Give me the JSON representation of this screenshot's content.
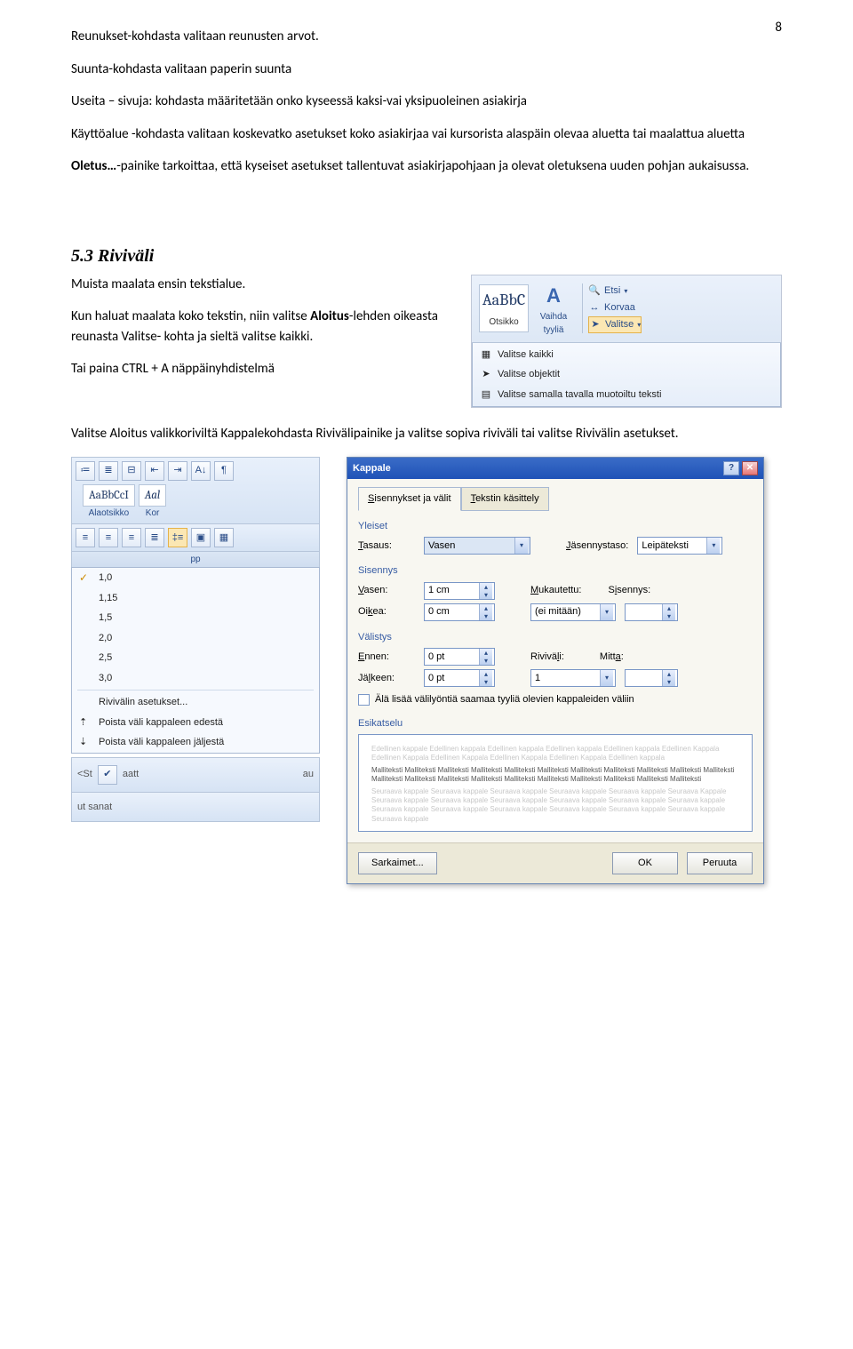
{
  "page_number": "8",
  "p1": "Reunukset-kohdasta  valitaan reunusten arvot.",
  "p2": "Suunta-kohdasta valitaan paperin suunta",
  "p3": "Useita – sivuja: kohdasta määritetään onko kyseessä kaksi-vai yksipuoleinen asiakirja",
  "p4": "Käyttöalue -kohdasta valitaan  koskevatko asetukset koko asiakirjaa vai kursorista alaspäin olevaa aluetta tai maalattua aluetta",
  "p5a": "Oletus…",
  "p5b": "-painike tarkoittaa, että kyseiset asetukset tallentuvat asiakirjapohjaan ja olevat oletuksena uuden pohjan aukaisussa.",
  "h53": "5.3 Riviväli",
  "r1": "Muista maalata ensin tekstialue.",
  "r2a": "Kun haluat maalata koko tekstin, niin valitse ",
  "r2b": "Aloitus",
  "r2c": "-lehden oikeasta reunasta Valitse- kohta  ja sieltä valitse kaikki.",
  "r3": "Tai paina CTRL + A näppäinyhdistelmä",
  "r4": "Valitse Aloitus valikkoriviltä Kappalekohdasta Rivivälipainike ja valitse sopiva riviväli tai valitse Rivivälin asetukset.",
  "ribbon": {
    "style1_aa": "AaBbC",
    "style1_lbl": "Otsikko",
    "changeStyle": "Vaihda tyyliä",
    "find": "Etsi",
    "replace": "Korvaa",
    "select": "Valitse",
    "selMenu": {
      "all": "Valitse kaikki",
      "objects": "Valitse objektit",
      "similar": "Valitse samalla tavalla muotoiltu teksti"
    }
  },
  "linespace": {
    "tb_style1": "AaBbCcI",
    "tb_style1_lbl": "Alaotsikko",
    "tb_style2": "Aal",
    "tb_style2_lbl": "Kor",
    "pp": "pp",
    "items": [
      "1,0",
      "1,15",
      "1,5",
      "2,0",
      "2,5",
      "3,0"
    ],
    "settings": "Rivivälin asetukset...",
    "removeBefore": "Poista väli kappaleen edestä",
    "removeAfter": "Poista väli kappaleen jäljestä",
    "extraleft1": "<St",
    "extraleft2": "aatt",
    "extraleft3": "ut sanat",
    "extraleft4": "au"
  },
  "dialog": {
    "title": "Kappale",
    "tab1": "Sisennykset ja välit",
    "tab2": "Tekstin käsittely",
    "g_general": "Yleiset",
    "l_align": "Tasaus:",
    "v_align": "Vasen",
    "l_outline": "Jäsennystaso:",
    "v_outline": "Leipäteksti",
    "g_indent": "Sisennys",
    "l_left": "Vasen:",
    "v_left": "1 cm",
    "l_right": "Oikea:",
    "v_right": "0 cm",
    "l_special": "Mukautettu:",
    "v_special": "(ei mitään)",
    "l_by": "Sisennys:",
    "g_spacing": "Välistys",
    "l_before": "Ennen:",
    "v_before": "0 pt",
    "l_after": "Jälkeen:",
    "v_after": "0 pt",
    "l_linespace": "Riviväli:",
    "v_linespace": "1",
    "l_at": "Mitta:",
    "chk_nospace": "Älä lisää välilyöntiä saamaa tyyliä olevien kappaleiden väliin",
    "g_preview": "Esikatselu",
    "btn_tabs": "Sarkaimet...",
    "btn_ok": "OK",
    "btn_cancel": "Peruuta",
    "prev_light": "Edellinen kappale Edellinen kappala Edellinen kappala Edellinen kappala Edellinen kappala Edellinen Kappala Edellinen Kappala Edellinen Kappala Edellinen Kappala Edellinen Kappala Edellinen kappala",
    "prev_dark": "Malliteksti Malliteksti Malliteksti Malliteksti Malliteksti Malliteksti Malliteksti Malliteksti Malliteksti Malliteksti Malliteksti Malliteksti Malliteksti Malliteksti Malliteksti Malliteksti Malliteksti Malliteksti Malliteksti Malliteksti Malliteksti",
    "prev_after": "Seuraava kappale Seuraava kappale Seuraava kappale Seuraava kappale Seuraava kappale Seuraava Kappale Seuraava kappale Seuraava kappale Seuraava kappale Seuraava kappale Seuraava kappale Seuraava kappale Seuraava kappale Seuraava kappale Seuraava kappale Seuraava kappale Seuraava kappale Seuraava kappale Seuraava kappale"
  }
}
